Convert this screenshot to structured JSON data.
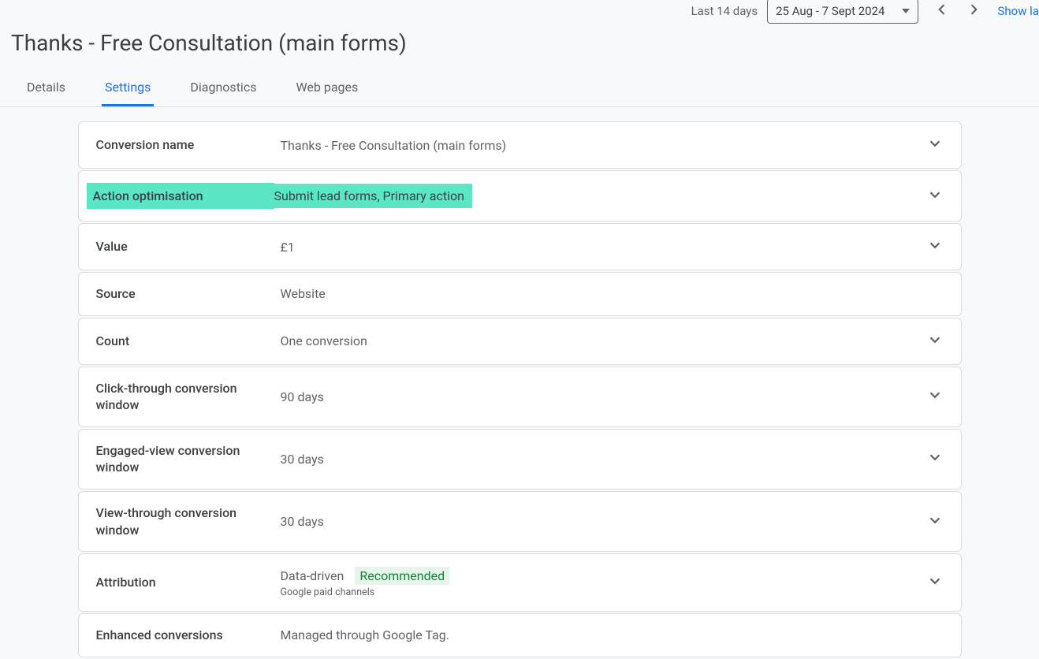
{
  "header": {
    "last_days_label": "Last 14 days",
    "date_range": "25 Aug - 7 Sept 2024",
    "show_link": "Show la",
    "page_title": "Thanks - Free Consultation (main forms)"
  },
  "tabs": [
    {
      "label": "Details"
    },
    {
      "label": "Settings"
    },
    {
      "label": "Diagnostics"
    },
    {
      "label": "Web pages"
    }
  ],
  "settings": {
    "conversion_name": {
      "label": "Conversion name",
      "value": "Thanks - Free Consultation (main forms)"
    },
    "action_optimisation": {
      "label": "Action optimisation",
      "value": "Submit lead forms, Primary action"
    },
    "value": {
      "label": "Value",
      "value": "£1"
    },
    "source": {
      "label": "Source",
      "value": "Website"
    },
    "count": {
      "label": "Count",
      "value": "One conversion"
    },
    "click_through": {
      "label": "Click-through conversion window",
      "value": "90 days"
    },
    "engaged_view": {
      "label": "Engaged-view conversion window",
      "value": "30 days"
    },
    "view_through": {
      "label": "View-through conversion window",
      "value": "30 days"
    },
    "attribution": {
      "label": "Attribution",
      "value": "Data-driven",
      "badge": "Recommended",
      "sub": "Google paid channels"
    },
    "enhanced": {
      "label": "Enhanced conversions",
      "value": "Managed through Google Tag."
    }
  }
}
